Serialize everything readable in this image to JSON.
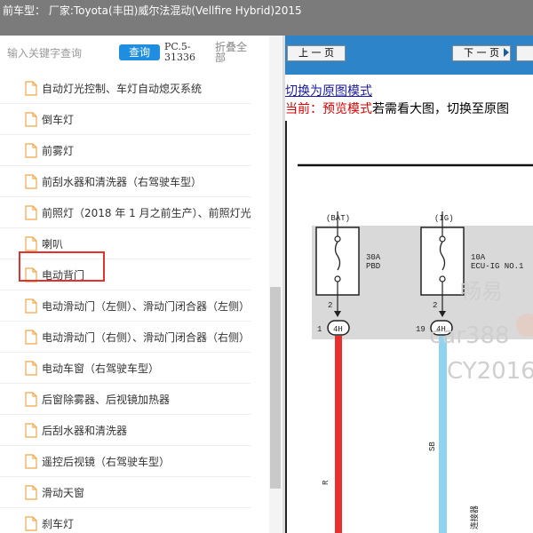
{
  "header": {
    "title": "前车型： 厂家:Toyota(丰田)威尔法混动(Vellfire Hybrid)2015"
  },
  "search": {
    "placeholder": "输入关键字查询",
    "button_label": "查询",
    "code": "PC.5-31336",
    "fold_label": "折叠全部"
  },
  "tree": {
    "items": [
      {
        "label": "自动灯光控制、车灯自动熄灭系统"
      },
      {
        "label": "倒车灯"
      },
      {
        "label": "前雾灯"
      },
      {
        "label": "前刮水器和清洗器（右驾驶车型）"
      },
      {
        "label": "前照灯（2018 年 1 月之前生产）、前照灯光"
      },
      {
        "label": "喇叭"
      },
      {
        "label": "电动背门"
      },
      {
        "label": "电动滑动门（左侧）、滑动门闭合器（左侧）"
      },
      {
        "label": "电动滑动门（右侧）、滑动门闭合器（右侧）"
      },
      {
        "label": "电动车窗（右驾驶车型）"
      },
      {
        "label": "后窗除雾器、后视镜加热器"
      },
      {
        "label": "后刮水器和清洗器"
      },
      {
        "label": "遥控后视镜（右驾驶车型）"
      },
      {
        "label": "滑动天窗"
      },
      {
        "label": "刹车灯"
      }
    ],
    "highlighted_item": "电动背门"
  },
  "viewer": {
    "prev_label": "上 一 页",
    "next_label": "下 一 页",
    "mode_link": "切换为原图模式",
    "current_prefix": "当前：",
    "current_mode": "预览模式",
    "hint": "若需看大图，切换至原图"
  },
  "diagram": {
    "bat_label": "(BAT)",
    "ig_label": "(IG)",
    "fuse1_rating": "30A",
    "fuse1_name": "PBD",
    "fuse2_rating": "10A",
    "fuse2_name": "ECU-IG NO.1",
    "pin_2a": "2",
    "pin_2b": "2",
    "pin_1": "1",
    "pin_19": "19",
    "conn_a": "4H",
    "conn_b": "4H",
    "wire_r": "R",
    "wire_sb": "SB",
    "joint_label": "连接器",
    "watermark1": "畅易",
    "watermark2": "car388",
    "watermark3": "CY2016"
  },
  "colors": {
    "topbar": "#7b7b7b",
    "search_button": "#1f8ee0",
    "navbar": "#2e84c9",
    "highlight_box": "#e0322e",
    "wire_red": "#e8312f",
    "wire_skyblue": "#8fd3ee",
    "fuse_box": "#d9d9d9"
  }
}
